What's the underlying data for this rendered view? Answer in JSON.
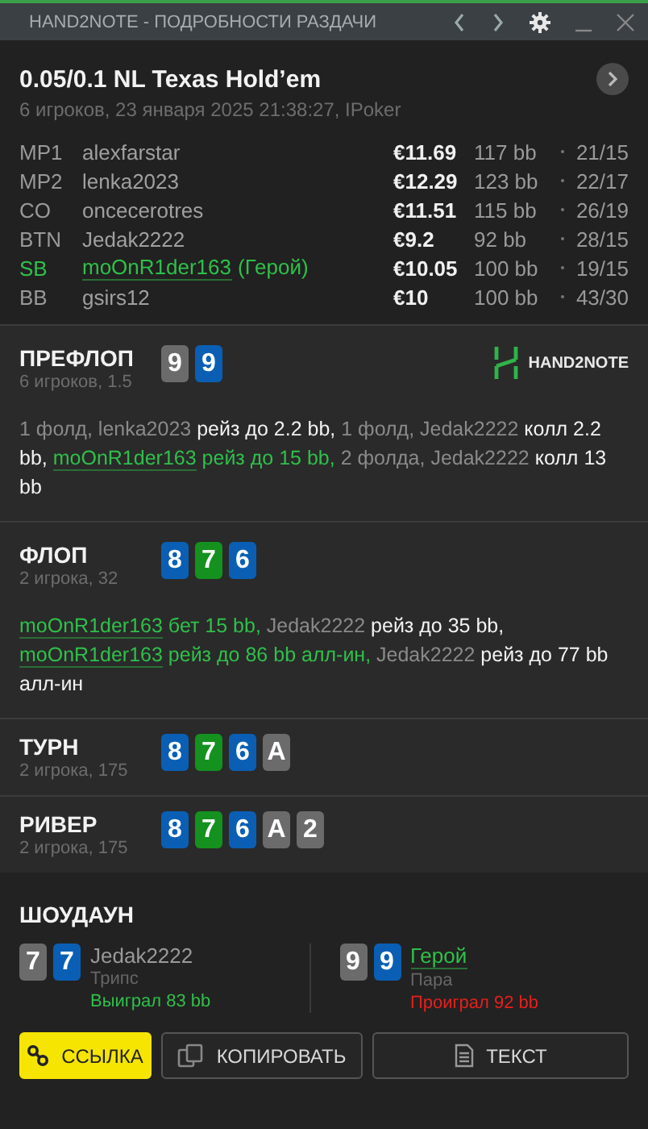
{
  "window": {
    "title": "HAND2NOTE - ПОДРОБНОСТИ РАЗДАЧИ"
  },
  "hand": {
    "title": "0.05/0.1 NL Texas Hold’em",
    "subtitle": "6 игроков, 23 января 2025 21:38:27, IPoker"
  },
  "players": [
    {
      "position": "MP1",
      "name": "alexfarstar",
      "hero": false,
      "stack": "€11.69",
      "bb": "117 bb",
      "stats": "21/15"
    },
    {
      "position": "MP2",
      "name": "lenka2023",
      "hero": false,
      "stack": "€12.29",
      "bb": "123 bb",
      "stats": "22/17"
    },
    {
      "position": "CO",
      "name": "oncecerotres",
      "hero": false,
      "stack": "€11.51",
      "bb": "115 bb",
      "stats": "26/19"
    },
    {
      "position": "BTN",
      "name": "Jedak2222",
      "hero": false,
      "stack": "€9.2",
      "bb": "92 bb",
      "stats": "28/15"
    },
    {
      "position": "SB",
      "name": "moOnR1der163",
      "hero": true,
      "hero_label": "(Герой)",
      "stack": "€10.05",
      "bb": "100 bb",
      "stats": "19/15"
    },
    {
      "position": "BB",
      "name": "gsirs12",
      "hero": false,
      "stack": "€10",
      "bb": "100 bb",
      "stats": "43/30"
    }
  ],
  "streets": [
    {
      "name": "ПРЕФЛОП",
      "info": "6 игроков, 1.5",
      "logo": "HAND2NOTE",
      "cards": [
        {
          "rank": "9",
          "color": "#6b6b6b"
        },
        {
          "rank": "9",
          "color": "#0a5fb4"
        }
      ],
      "actions": [
        {
          "kind": "muted",
          "text": "1 фолд, lenka2023 "
        },
        {
          "kind": "bold",
          "text": "рейз до 2.2 bb, "
        },
        {
          "kind": "muted",
          "text": "1 фолд, Jedak2222 "
        },
        {
          "kind": "bold",
          "text": "колл 2.2 bb, "
        },
        {
          "kind": "hero_name",
          "text": "moOnR1der163"
        },
        {
          "kind": "hero",
          "text": " рейз до 15 bb, "
        },
        {
          "kind": "muted",
          "text": "2 фолда, Jedak2222 "
        },
        {
          "kind": "bold",
          "text": "колл 13 bb"
        }
      ]
    },
    {
      "name": "ФЛОП",
      "info": "2 игрока, 32",
      "cards": [
        {
          "rank": "8",
          "color": "#0a5fb4"
        },
        {
          "rank": "7",
          "color": "#14911e"
        },
        {
          "rank": "6",
          "color": "#0a5fb4"
        }
      ],
      "actions": [
        {
          "kind": "hero_name",
          "text": "moOnR1der163"
        },
        {
          "kind": "hero",
          "text": " бет 15 bb, "
        },
        {
          "kind": "muted",
          "text": "Jedak2222 "
        },
        {
          "kind": "bold",
          "text": "рейз до 35 bb, "
        },
        {
          "kind": "hero_name",
          "text": "moOnR1der163"
        },
        {
          "kind": "hero",
          "text": " рейз до 86 bb алл-ин, "
        },
        {
          "kind": "muted",
          "text": "Jedak2222 "
        },
        {
          "kind": "bold",
          "text": "рейз до 77 bb алл-ин"
        }
      ]
    },
    {
      "name": "ТУРН",
      "info": "2 игрока, 175",
      "cards": [
        {
          "rank": "8",
          "color": "#0a5fb4"
        },
        {
          "rank": "7",
          "color": "#14911e"
        },
        {
          "rank": "6",
          "color": "#0a5fb4"
        },
        {
          "rank": "A",
          "color": "#6b6b6b"
        }
      ]
    },
    {
      "name": "РИВЕР",
      "info": "2 игрока, 175",
      "cards": [
        {
          "rank": "8",
          "color": "#0a5fb4"
        },
        {
          "rank": "7",
          "color": "#14911e"
        },
        {
          "rank": "6",
          "color": "#0a5fb4"
        },
        {
          "rank": "A",
          "color": "#6b6b6b"
        },
        {
          "rank": "2",
          "color": "#6b6b6b"
        }
      ]
    }
  ],
  "showdown": {
    "title": "ШОУДАУН",
    "hands": [
      {
        "cards": [
          {
            "rank": "7",
            "color": "#6b6b6b"
          },
          {
            "rank": "7",
            "color": "#0a5fb4"
          }
        ],
        "name": "Jedak2222",
        "hero": false,
        "combo": "Трипс",
        "result": "Выиграл 83 bb",
        "won": true
      },
      {
        "cards": [
          {
            "rank": "9",
            "color": "#6b6b6b"
          },
          {
            "rank": "9",
            "color": "#0a5fb4"
          }
        ],
        "name": "Герой",
        "hero": true,
        "combo": "Пара",
        "result": "Проиграл 92 bb",
        "won": false
      }
    ]
  },
  "buttons": [
    {
      "kind": "link",
      "label": "ССЫЛКА"
    },
    {
      "kind": "copy",
      "label": "КОПИРОВАТЬ"
    },
    {
      "kind": "text",
      "label": "ТЕКСТ"
    }
  ]
}
